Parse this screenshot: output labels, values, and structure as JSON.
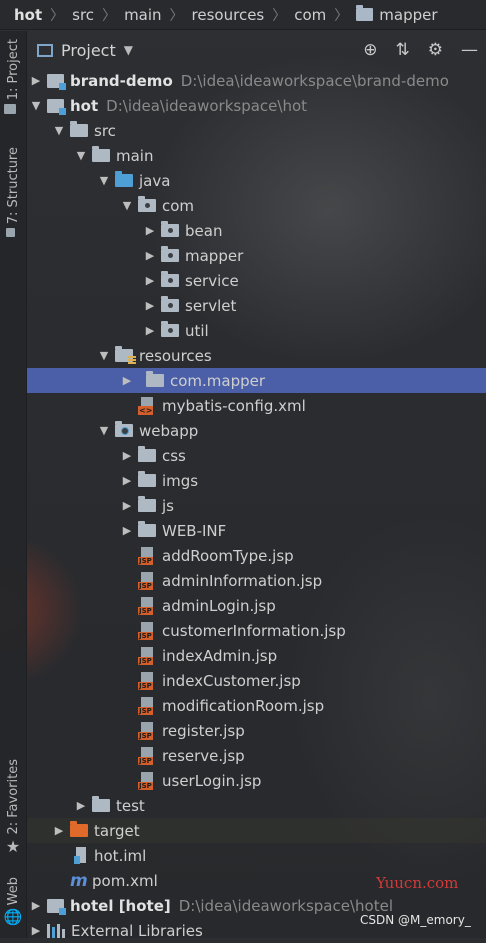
{
  "breadcrumb": {
    "items": [
      "hot",
      "src",
      "main",
      "resources",
      "com",
      "mapper"
    ]
  },
  "sidebar": {
    "tab_project": "1: Project",
    "tab_structure": "7: Structure",
    "tab_favorites": "2: Favorites",
    "tab_web": "Web"
  },
  "panel": {
    "title": "Project",
    "tools": [
      "target-icon",
      "collapse-icon",
      "gear-icon",
      "minimize-icon"
    ]
  },
  "tree": {
    "brand_demo": {
      "name": "brand-demo",
      "path": "D:\\idea\\ideaworkspace\\brand-demo"
    },
    "hot": {
      "name": "hot",
      "path": "D:\\idea\\ideaworkspace\\hot"
    },
    "src": "src",
    "main": "main",
    "java": "java",
    "com": "com",
    "bean": "bean",
    "mapper": "mapper",
    "service": "service",
    "servlet": "servlet",
    "util": "util",
    "resources": "resources",
    "com_mapper": "com.mapper",
    "mybatis_config": "mybatis-config.xml",
    "webapp": "webapp",
    "css": "css",
    "imgs": "imgs",
    "js": "js",
    "web_inf": "WEB-INF",
    "jsp_files": [
      "addRoomType.jsp",
      "adminInformation.jsp",
      "adminLogin.jsp",
      "customerInformation.jsp",
      "indexAdmin.jsp",
      "indexCustomer.jsp",
      "modificationRoom.jsp",
      "register.jsp",
      "reserve.jsp",
      "userLogin.jsp"
    ],
    "test": "test",
    "target": "target",
    "hot_iml": "hot.iml",
    "pom": "pom.xml",
    "hotel": {
      "name": "hotel [hote]",
      "path": "D:\\idea\\ideaworkspace\\hotel"
    },
    "external_libraries": "External Libraries"
  },
  "watermarks": {
    "site": "Yuucn.com",
    "csdn": "CSDN @M_emory_"
  },
  "colors": {
    "selection": "#4a5fa8",
    "jsp_badge": "#d55f2a",
    "source_folder": "#4e9fd6",
    "excluded_folder": "#e06a2a"
  }
}
